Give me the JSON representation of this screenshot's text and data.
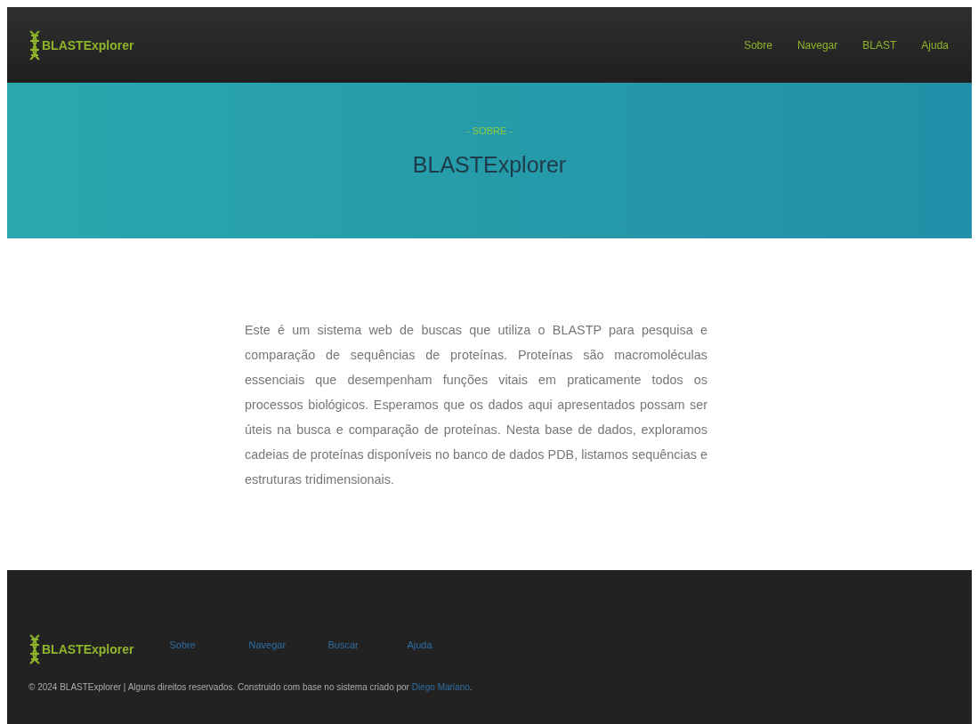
{
  "header": {
    "brand": "BLASTExplorer",
    "nav": [
      {
        "label": "Sobre"
      },
      {
        "label": "Navegar"
      },
      {
        "label": "BLAST"
      },
      {
        "label": "Ajuda"
      }
    ]
  },
  "hero": {
    "eyebrow": "- SOBRE -",
    "title": "BLASTExplorer"
  },
  "about": "Este é um sistema web de buscas que utiliza o BLASTP para pesquisa e comparação de sequências de proteínas. Proteínas são macromoléculas essenciais que desempenham funções vitais em praticamente todos os processos biológicos. Esperamos que os dados aqui apresentados possam ser úteis na busca e comparação de proteínas. Nesta base de dados, exploramos cadeias de proteínas disponíveis no banco de dados PDB, listamos sequências e estruturas tridimensionais.",
  "footer": {
    "brand": "BLASTExplorer",
    "links": [
      {
        "label": "Sobre"
      },
      {
        "label": "Navegar"
      },
      {
        "label": "Buscar"
      },
      {
        "label": "Ajuda"
      }
    ],
    "copyright": {
      "before": "© 2024 BLASTExplorer | Alguns direitos reservados. Construido com base no sistema criado por ",
      "link": "Diego Mariano",
      "after": "."
    }
  }
}
